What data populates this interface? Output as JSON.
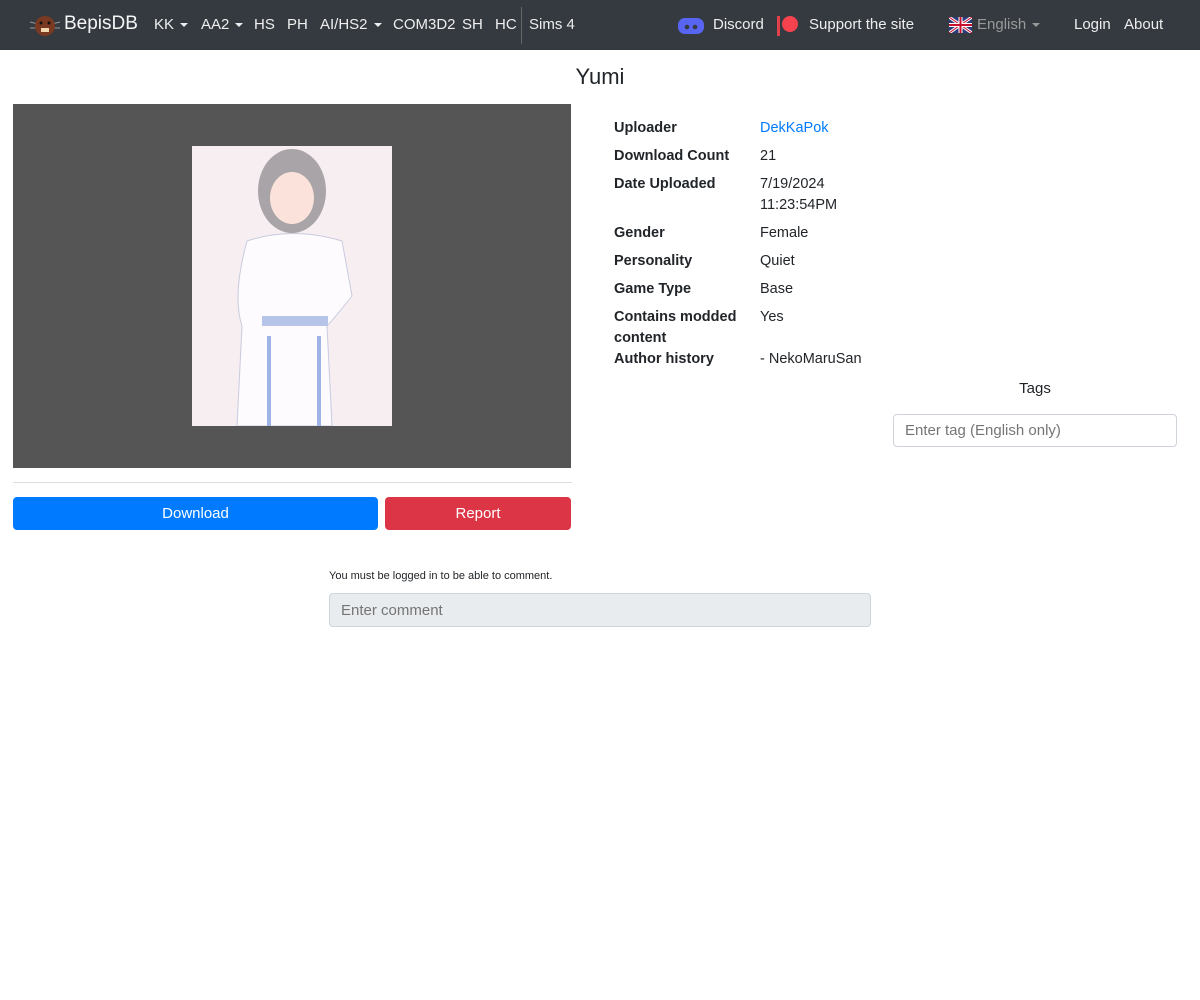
{
  "nav": {
    "brand": "BepisDB",
    "items": [
      {
        "label": "KK",
        "dropdown": true
      },
      {
        "label": "AA2",
        "dropdown": true
      },
      {
        "label": "HS"
      },
      {
        "label": "PH"
      },
      {
        "label": "AI/HS2",
        "dropdown": true
      },
      {
        "label": "COM3D2"
      },
      {
        "label": "SH"
      },
      {
        "label": "HC"
      },
      {
        "label": "Sims 4"
      }
    ],
    "discord": "Discord",
    "support": "Support the site",
    "language": "English",
    "login": "Login",
    "about": "About"
  },
  "card": {
    "title": "Yumi",
    "download": "Download",
    "report": "Report",
    "info": [
      {
        "label": "Uploader",
        "value": "DekKaPok"
      },
      {
        "label": "Download Count",
        "value": "21"
      },
      {
        "label": "Date Uploaded",
        "value": "7/19/2024 11:23:54PM"
      },
      {
        "label": "Gender",
        "value": "Female"
      },
      {
        "label": "Personality",
        "value": "Quiet"
      },
      {
        "label": "Game Type",
        "value": "Base"
      },
      {
        "label": "Contains modded content",
        "value": "Yes"
      },
      {
        "label": "Author history",
        "value": "- NekoMaruSan"
      }
    ],
    "tags_label": "Tags",
    "tag_placeholder": "Enter tag (English only)"
  },
  "comments": {
    "notice": "You must be logged in to be able to comment.",
    "placeholder": "Enter comment"
  },
  "colors": {
    "nav": "#343a40",
    "primary": "#007bff",
    "danger": "#dc3545",
    "link": "#007bff"
  }
}
